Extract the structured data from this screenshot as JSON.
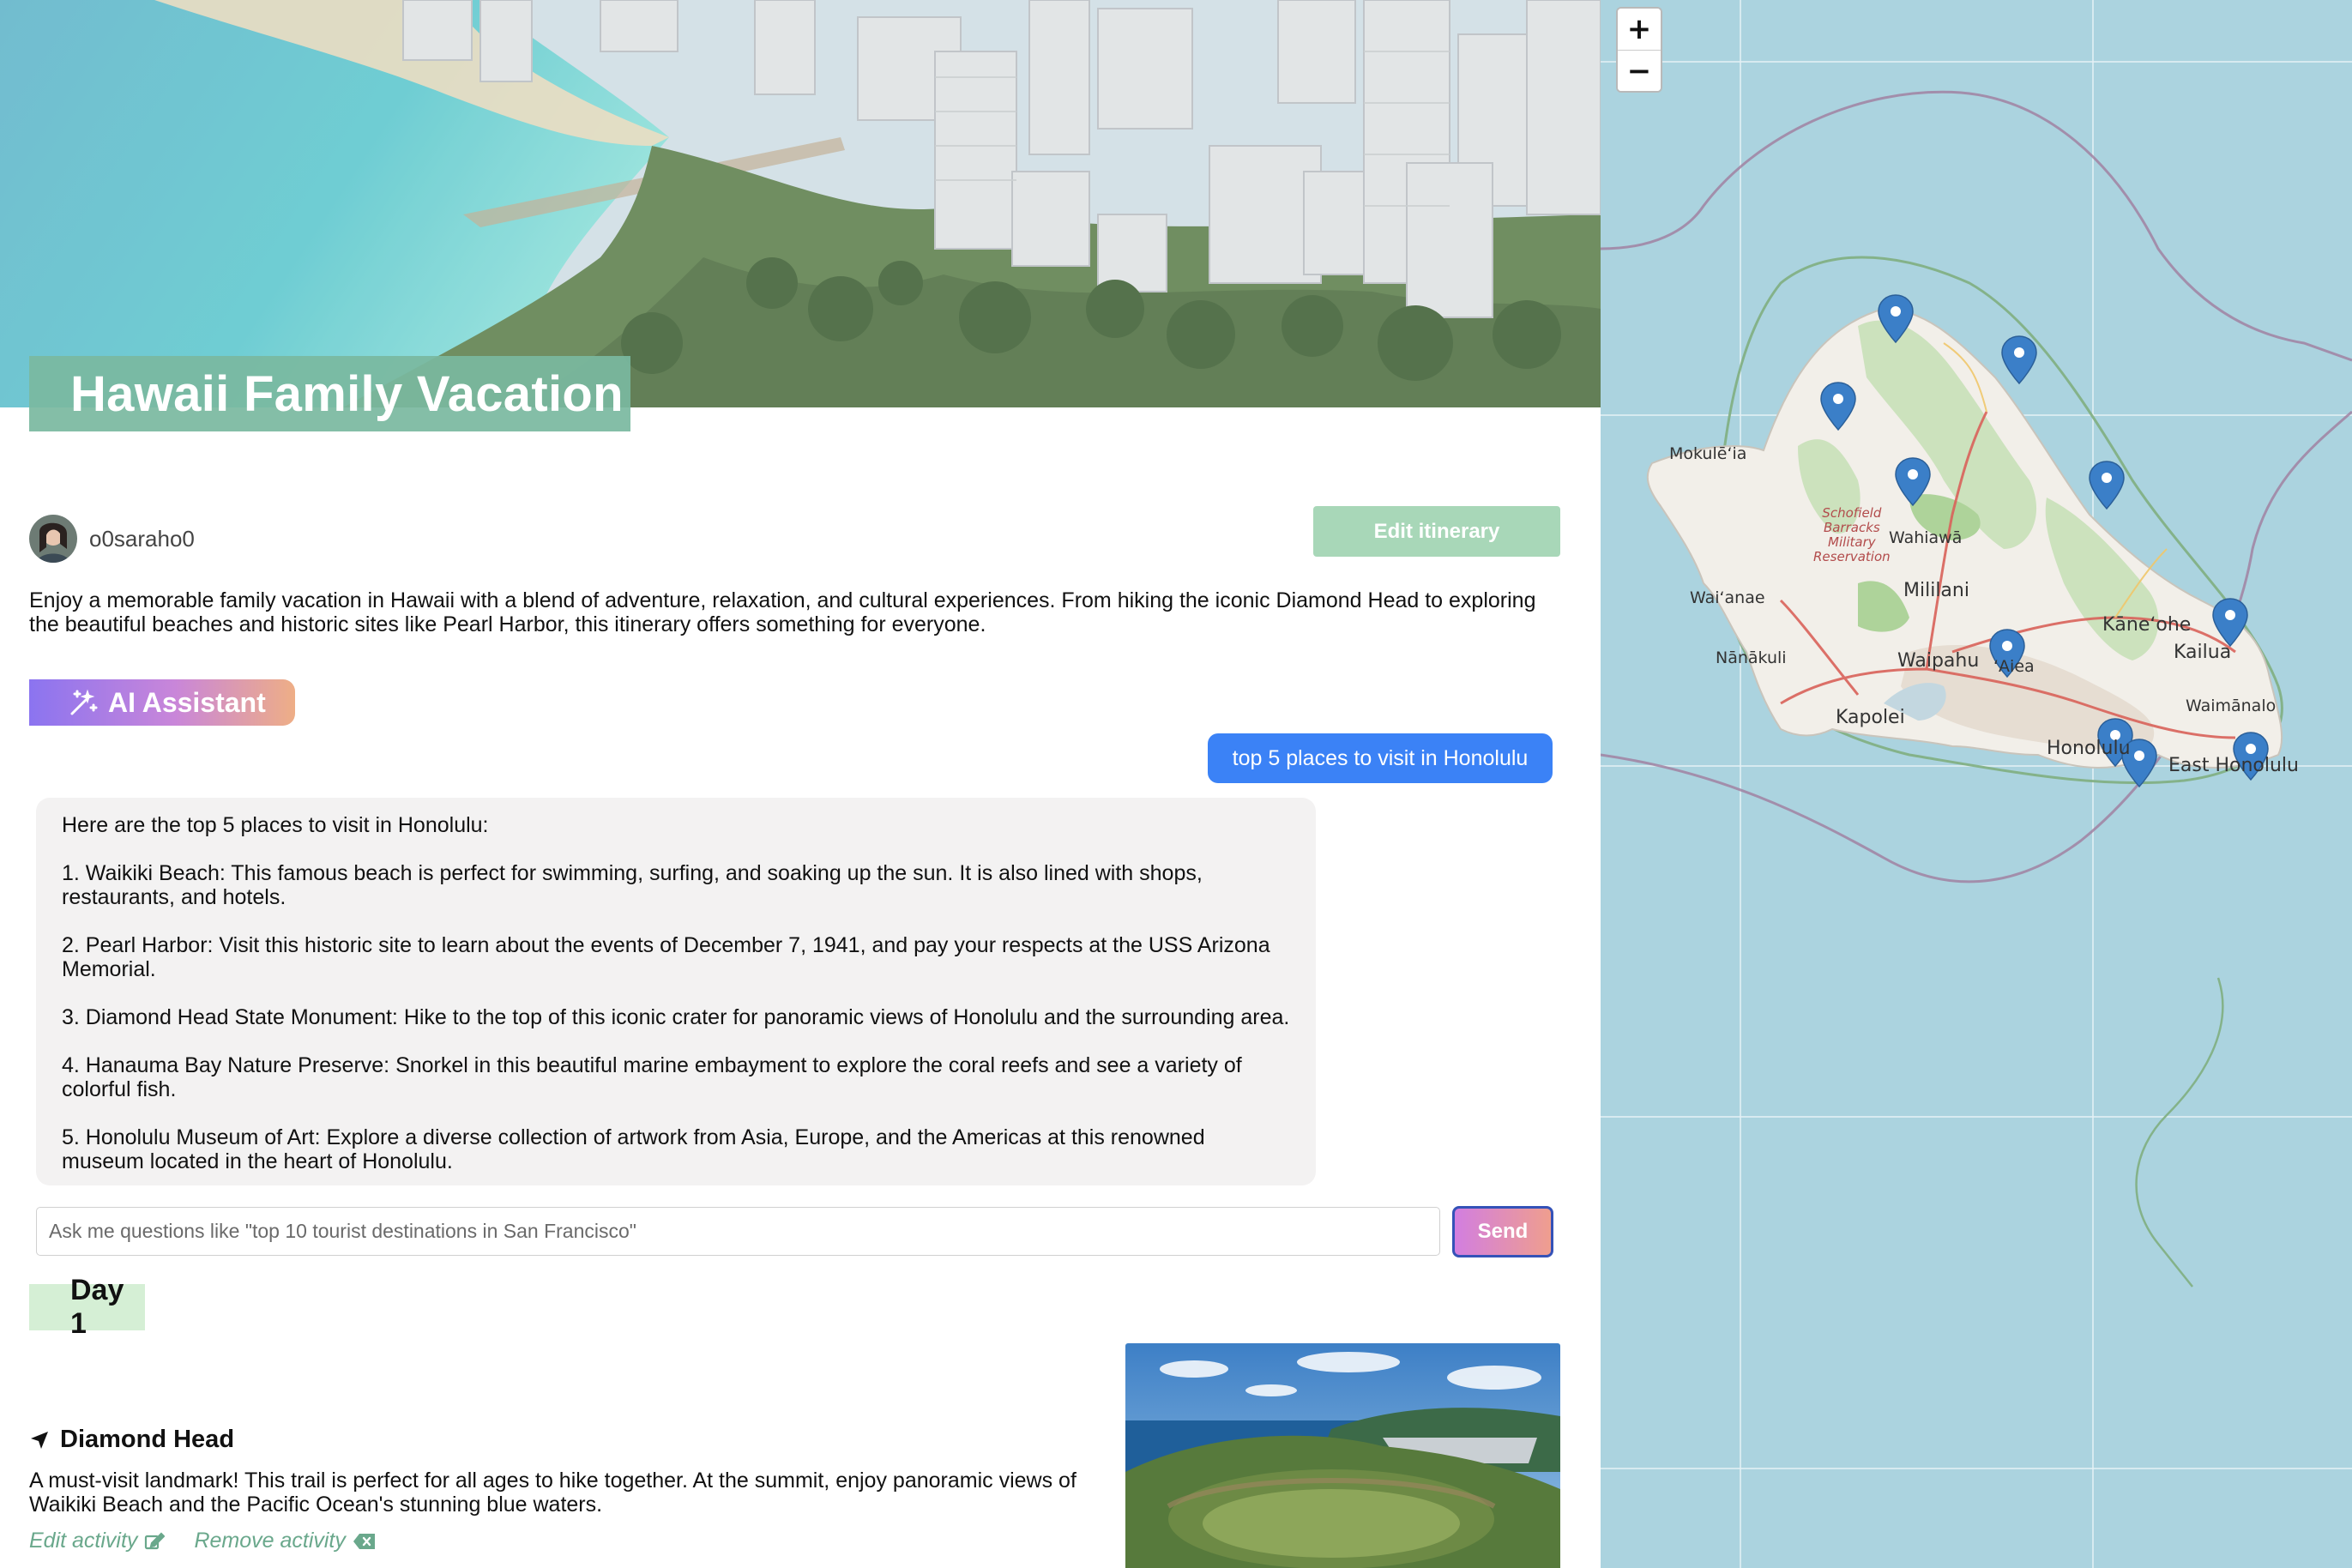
{
  "trip": {
    "title": "Hawaii Family Vacation",
    "username": "o0saraho0",
    "edit_itinerary_label": "Edit itinerary",
    "description": "Enjoy a memorable family vacation in Hawaii with a blend of adventure, relaxation, and cultural experiences. From hiking the iconic Diamond Head to exploring the beautiful beaches and historic sites like Pearl Harbor, this itinerary offers something for everyone."
  },
  "assistant": {
    "badge_label": "AI Assistant",
    "user_message": "top 5 places to visit in Honolulu",
    "reply": [
      "Here are the top 5 places to visit in Honolulu:",
      "1. Waikiki Beach: This famous beach is perfect for swimming, surfing, and soaking up the sun. It is also lined with shops, restaurants, and hotels.",
      "2. Pearl Harbor: Visit this historic site to learn about the events of December 7, 1941, and pay your respects at the USS Arizona Memorial.",
      "3. Diamond Head State Monument: Hike to the top of this iconic crater for panoramic views of Honolulu and the surrounding area.",
      "4. Hanauma Bay Nature Preserve: Snorkel in this beautiful marine embayment to explore the coral reefs and see a variety of colorful fish.",
      "5. Honolulu Museum of Art: Explore a diverse collection of artwork from Asia, Europe, and the Americas at this renowned museum located in the heart of Honolulu."
    ],
    "input_placeholder": "Ask me questions like \"top 10 tourist destinations in San Francisco\"",
    "input_value": "",
    "send_label": "Send"
  },
  "itinerary": {
    "day_label": "Day 1",
    "activity": {
      "title": "Diamond Head",
      "icon": "navigation-arrow-icon",
      "description": "A must-visit landmark! This trail is perfect for all ages to hike together. At the summit, enjoy panoramic views of Waikiki Beach and the Pacific Ocean's stunning blue waters.",
      "edit_label": "Edit activity",
      "remove_label": "Remove activity"
    }
  },
  "map": {
    "zoom_in": "+",
    "zoom_out": "−",
    "labels": {
      "mokuleia": "Mokulēʻia",
      "schofield": "Schofield\nBarracks\nMilitary\nReservation",
      "wahiawa": "Wahiawā",
      "waianae": "Waiʻanae",
      "mililani": "Mililani",
      "kaneohe": "Kāneʻohe",
      "kailua": "Kailua",
      "nanakuli": "Nānākuli",
      "waipahu": "Waipahu",
      "aiea": "ʻAiea",
      "waimanalo": "Waimānalo",
      "kapolei": "Kapolei",
      "honolulu": "Honolulu",
      "east_honolulu": "East Honolulu"
    }
  },
  "colors": {
    "title_banner": "#7ab9a0",
    "edit_button": "#a8d7b8",
    "user_bubble": "#3b82f6",
    "reply_bubble": "#f3f2f2",
    "day_label_bg": "#d5efd5",
    "activity_link": "#6aa88c",
    "map_water": "#abd3df",
    "marker": "#3b7fc8"
  }
}
